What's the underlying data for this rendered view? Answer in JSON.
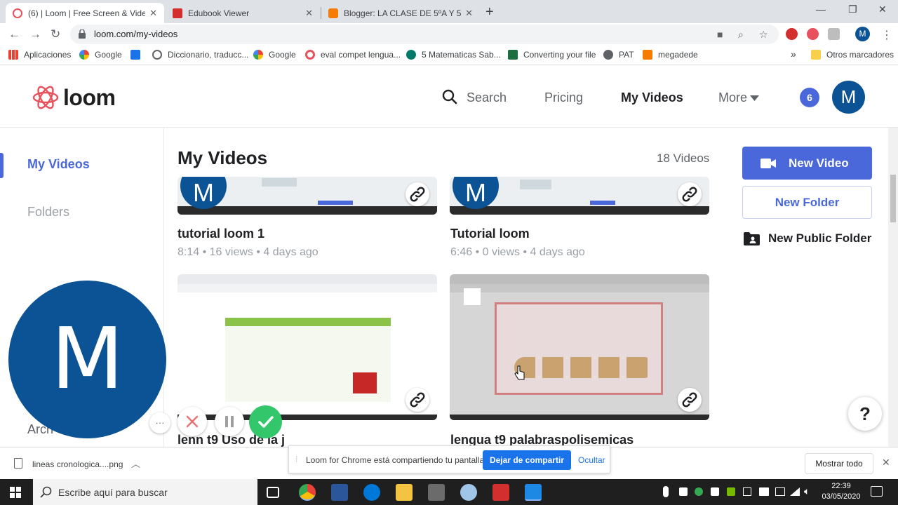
{
  "browser": {
    "tabs": [
      {
        "title": "(6) | Loom | Free Screen & Video",
        "favicon_color": "#e8505b",
        "active": true
      },
      {
        "title": "Edubook Viewer",
        "favicon_color": "#d32f2f",
        "active": false
      },
      {
        "title": "Blogger: LA CLASE DE 5ºA Y 5ºB",
        "favicon_color": "#f57c00",
        "active": false
      }
    ],
    "url": "loom.com/my-videos",
    "profile_initial": "M",
    "bookmarks": [
      {
        "label": "Aplicaciones",
        "icon": "apps-grid-icon"
      },
      {
        "label": "Google",
        "icon": "google-icon"
      },
      {
        "label": "",
        "icon": "download-icon"
      },
      {
        "label": "Diccionario, traducc...",
        "icon": "dictionary-icon"
      },
      {
        "label": "Google",
        "icon": "google-icon"
      },
      {
        "label": "eval compet lengua...",
        "icon": "target-icon"
      },
      {
        "label": "5 Matematicas Sab...",
        "icon": "s-icon"
      },
      {
        "label": "Converting your file",
        "icon": "excel-icon"
      },
      {
        "label": "PAT",
        "icon": "globe-icon"
      },
      {
        "label": "megadede",
        "icon": "m-icon"
      }
    ],
    "bookmarks_more": "»",
    "other_bookmarks": "Otros marcadores"
  },
  "loom": {
    "logo_text": "loom",
    "nav": {
      "search": "Search",
      "pricing": "Pricing",
      "my_videos": "My Videos",
      "more": "More"
    },
    "notification_count": "6",
    "avatar_initial": "M",
    "sidebar": {
      "my_videos": "My Videos",
      "folders": "Folders",
      "archive_partial": "Arch"
    },
    "page_title": "My Videos",
    "video_count": "18 Videos",
    "videos": [
      {
        "title": "tutorial loom 1",
        "duration": "8:14",
        "views": "16 views",
        "age": "4 days ago"
      },
      {
        "title": "Tutorial loom",
        "duration": "6:46",
        "views": "0 views",
        "age": "4 days ago"
      },
      {
        "title": "lenn t9 Uso de la j",
        "duration": "",
        "views": "",
        "age": ""
      },
      {
        "title": "lengua t9 palabraspolisemicas",
        "duration": "",
        "views": "",
        "age": ""
      }
    ],
    "meta_separator": "•",
    "actions": {
      "new_video": "New Video",
      "new_folder": "New Folder",
      "new_public_folder": "New Public Folder"
    },
    "help": "?",
    "recorder": {
      "camera_initial": "M",
      "more": "···"
    },
    "accent_color": "#4a68d9"
  },
  "downloads": {
    "file": "lineas cronologica....png",
    "show_all": "Mostrar todo"
  },
  "sharing_bar": {
    "message": "Loom for Chrome está compartiendo tu pantalla.",
    "stop": "Dejar de compartir",
    "hide": "Ocultar"
  },
  "taskbar": {
    "search_placeholder": "Escribe aquí para buscar",
    "time": "22:39",
    "date": "03/05/2020"
  }
}
